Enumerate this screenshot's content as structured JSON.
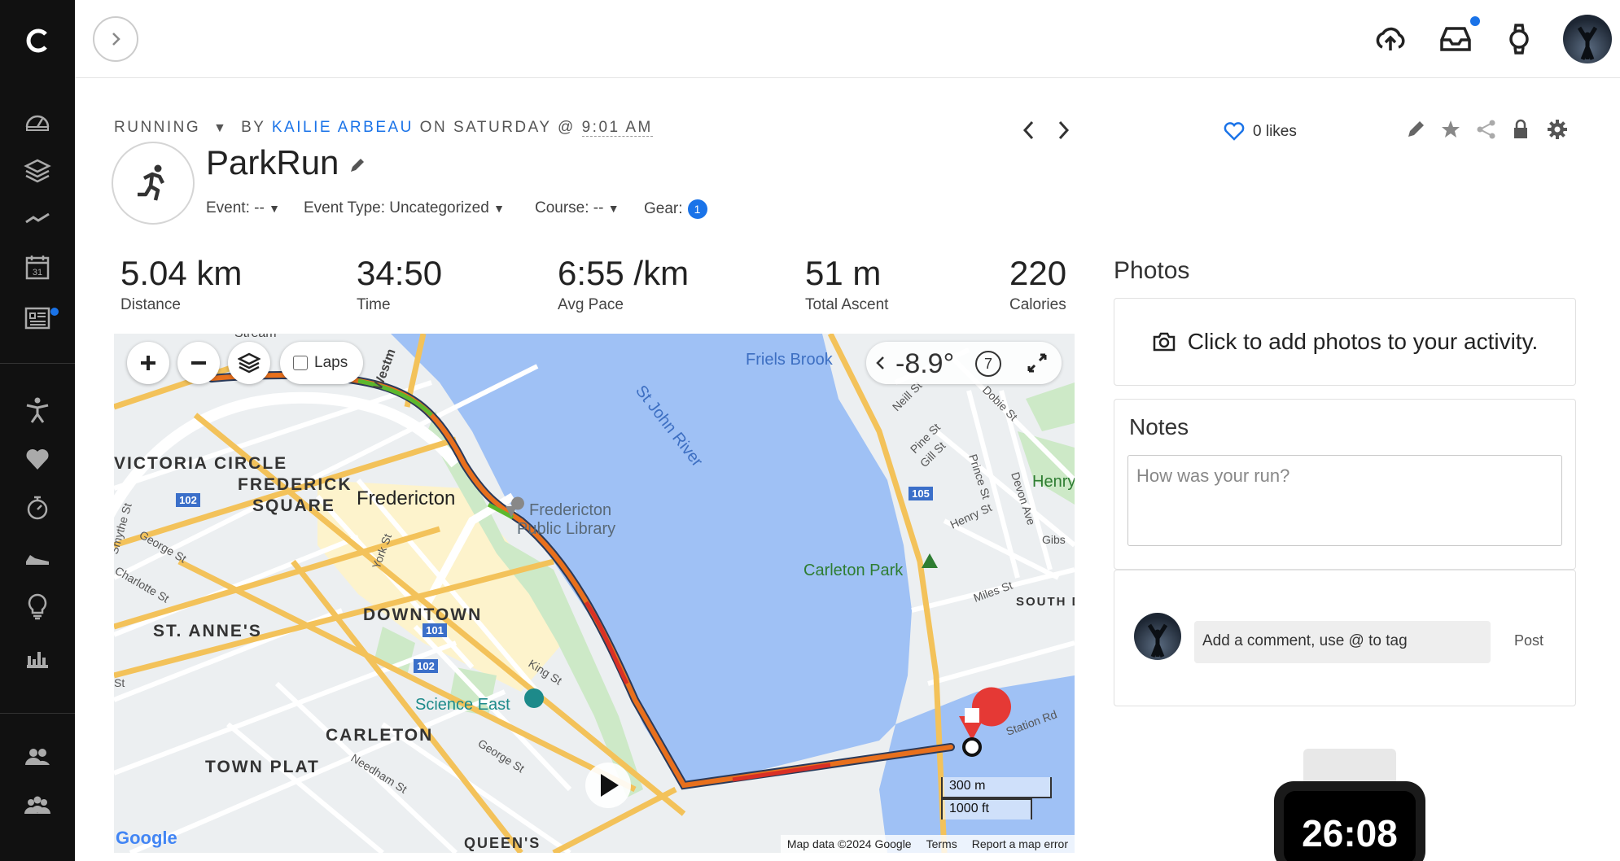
{
  "header": {
    "activity_type": "RUNNING",
    "by": "BY",
    "author": "KAILIE ARBEAU",
    "on": "ON SATURDAY @",
    "time": "9:01 AM",
    "title": "ParkRun",
    "event": "Event: --",
    "event_type": "Event Type: Uncategorized",
    "course": "Course: --",
    "gear": "Gear:",
    "gear_count": "1",
    "likes": "0 likes"
  },
  "stats": [
    {
      "value": "5.04 km",
      "label": "Distance"
    },
    {
      "value": "34:50",
      "label": "Time"
    },
    {
      "value": "6:55 /km",
      "label": "Avg Pace"
    },
    {
      "value": "51 m",
      "label": "Total Ascent"
    },
    {
      "value": "220",
      "label": "Calories"
    }
  ],
  "map": {
    "laps_label": "Laps",
    "heading": "-8.9°",
    "heading_num": "7",
    "scale_m": "300 m",
    "scale_ft": "1000 ft",
    "attribution": "Map data ©2024 Google",
    "terms": "Terms",
    "report": "Report a map error",
    "google": "Google",
    "labels": {
      "victoria": "VICTORIA CIRCLE",
      "frederick1": "FREDERICK",
      "frederick2": "SQUARE",
      "fredericton": "Fredericton",
      "library1": "Fredericton",
      "library2": "Public Library",
      "downtown": "DOWNTOWN",
      "stannes": "ST. ANNE'S",
      "carleton": "CARLETON",
      "townplat": "TOWN PLAT",
      "science": "Science East",
      "carletonpark": "Carleton Park",
      "friels": "Friels Brook",
      "river": "St John River",
      "queens": "QUEEN'S",
      "southd": "SOUTH D",
      "henry": "Henry",
      "westm": "Westm",
      "stream": "Stream",
      "r102a": "102",
      "r102b": "102",
      "r101": "101",
      "r105": "105",
      "yorkst": "York St",
      "kingst": "King St",
      "georgest": "George St",
      "georgest2": "George St",
      "charlottest": "Charlotte St",
      "smythest": "Smythe St",
      "needhamst": "Needham St",
      "neillst": "Neill St",
      "pinest": "Pine St",
      "gillst": "Gill St",
      "princest": "Prince St",
      "dobiest": "Dobie St",
      "devonave": "Devon Ave",
      "henryst": "Henry St",
      "milesst": "Miles St",
      "stationrd": "Station Rd",
      "gibs": "Gibs",
      "st": "St"
    }
  },
  "photos": {
    "heading": "Photos",
    "cta": "Click to add photos to your activity."
  },
  "notes": {
    "heading": "Notes",
    "placeholder": "How was your run?"
  },
  "comment": {
    "placeholder": "Add a comment, use @ to tag",
    "post": "Post"
  },
  "watch": {
    "time": "26:08"
  },
  "colors": {
    "accent": "#1a73e8",
    "sidebar": "#111111",
    "water": "#9fc1f5",
    "route": "#e8701d"
  }
}
